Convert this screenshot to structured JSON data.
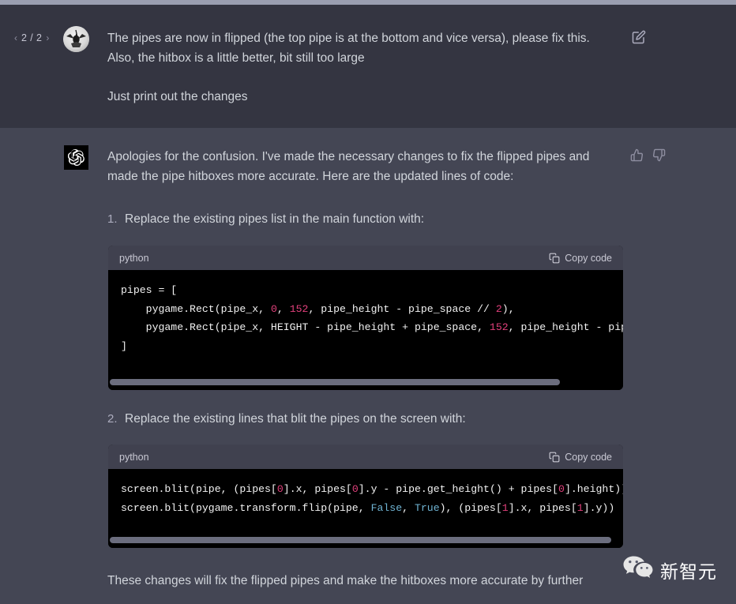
{
  "theme": {
    "user_bg": "#343541",
    "assistant_bg": "#444654",
    "code_bg": "#000000",
    "code_header_bg": "#40414f",
    "text": "#d1d5db",
    "muted": "#8e8ea0",
    "number_token": "#e0407b",
    "keyword_token": "#6fb3d2",
    "scrollbar_thumb": "#6b6d7e"
  },
  "user_message": {
    "pager": {
      "prev_icon": "chevron-left-icon",
      "prev_glyph": "‹",
      "count": "2 / 2",
      "next_icon": "chevron-right-icon",
      "next_glyph": "›"
    },
    "avatar_name": "user-avatar",
    "paragraphs": [
      "The pipes are now in flipped (the top pipe is at the bottom and vice versa), please fix this. Also, the hitbox is a little better, bit still too large",
      "Just print out the changes"
    ],
    "edit_icon": "edit-pencil-icon"
  },
  "assistant_message": {
    "avatar_name": "chatgpt-logo-icon",
    "intro": "Apologies for the confusion. I've made the necessary changes to fix the flipped pipes and made the pipe hitboxes more accurate. Here are the updated lines of code:",
    "feedback": {
      "thumbs_up_icon": "thumbs-up-icon",
      "thumbs_down_icon": "thumbs-down-icon"
    },
    "steps": [
      {
        "number": "1.",
        "text": "Replace the existing pipes list in the main function with:"
      },
      {
        "number": "2.",
        "text": "Replace the existing lines that blit the pipes on the screen with:"
      }
    ],
    "closing": "These changes will fix the flipped pipes and make the hitboxes more accurate by further"
  },
  "code_blocks": [
    {
      "language": "python",
      "copy_label": "Copy code",
      "copy_icon": "clipboard-icon",
      "scroll_percent": 88,
      "lines": [
        [
          {
            "t": "pipes = [",
            "c": "plain"
          }
        ],
        [
          {
            "t": "    pygame.Rect(pipe_x, ",
            "c": "plain"
          },
          {
            "t": "0",
            "c": "num"
          },
          {
            "t": ", ",
            "c": "plain"
          },
          {
            "t": "152",
            "c": "num"
          },
          {
            "t": ", pipe_height - pipe_space ",
            "c": "plain"
          },
          {
            "t": "//",
            "c": "op"
          },
          {
            "t": " ",
            "c": "plain"
          },
          {
            "t": "2",
            "c": "num"
          },
          {
            "t": "),",
            "c": "plain"
          }
        ],
        [
          {
            "t": "    pygame.Rect(pipe_x, HEIGHT - pipe_height + pipe_space, ",
            "c": "plain"
          },
          {
            "t": "152",
            "c": "num"
          },
          {
            "t": ", pipe_height - pipe_",
            "c": "plain"
          }
        ],
        [
          {
            "t": "]",
            "c": "plain"
          }
        ]
      ]
    },
    {
      "language": "python",
      "copy_label": "Copy code",
      "copy_icon": "clipboard-icon",
      "scroll_percent": 98,
      "lines": [
        [
          {
            "t": "screen.blit(pipe, (pipes[",
            "c": "plain"
          },
          {
            "t": "0",
            "c": "num"
          },
          {
            "t": "].x, pipes[",
            "c": "plain"
          },
          {
            "t": "0",
            "c": "num"
          },
          {
            "t": "].y - pipe.get_height() + pipes[",
            "c": "plain"
          },
          {
            "t": "0",
            "c": "num"
          },
          {
            "t": "].height))",
            "c": "plain"
          }
        ],
        [
          {
            "t": "screen.blit(pygame.transform.flip(pipe, ",
            "c": "plain"
          },
          {
            "t": "False",
            "c": "kw"
          },
          {
            "t": ", ",
            "c": "plain"
          },
          {
            "t": "True",
            "c": "kw"
          },
          {
            "t": "), (pipes[",
            "c": "plain"
          },
          {
            "t": "1",
            "c": "num"
          },
          {
            "t": "].x, pipes[",
            "c": "plain"
          },
          {
            "t": "1",
            "c": "num"
          },
          {
            "t": "].y))",
            "c": "plain"
          }
        ]
      ]
    }
  ],
  "watermark": {
    "icon": "wechat-logo-icon",
    "text": "新智元"
  }
}
